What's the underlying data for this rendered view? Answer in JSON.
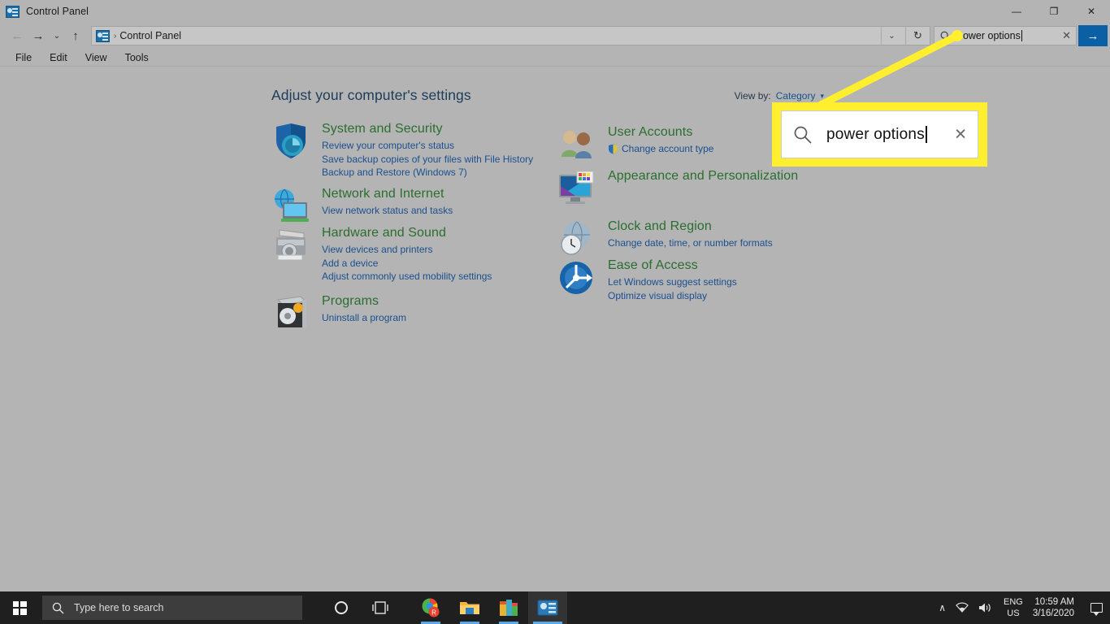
{
  "window": {
    "title": "Control Panel",
    "title_icon": "control-panel-icon",
    "minimize": "—",
    "maximize": "❐",
    "close": "✕"
  },
  "nav": {
    "back": "←",
    "forward": "→",
    "history": "⌄",
    "up": "↑",
    "breadcrumb_separator": "›",
    "breadcrumb": "Control Panel",
    "address_chevron": "⌄",
    "refresh": "↻"
  },
  "search": {
    "value": "power options",
    "clear_label": "✕",
    "go_label": "→",
    "icon": "search-icon"
  },
  "menu": {
    "items": [
      "File",
      "Edit",
      "View",
      "Tools"
    ]
  },
  "main": {
    "heading": "Adjust your computer's settings",
    "view_by_label": "View by:",
    "view_by_value": "Category",
    "view_by_caret": "▾"
  },
  "categories_left": [
    {
      "title": "System and Security",
      "icon": "shield-security-icon",
      "links": [
        "Review your computer's status",
        "Save backup copies of your files with File History",
        "Backup and Restore (Windows 7)"
      ]
    },
    {
      "title": "Network and Internet",
      "icon": "network-globe-icon",
      "links": [
        "View network status and tasks"
      ]
    },
    {
      "title": "Hardware and Sound",
      "icon": "printer-icon",
      "links": [
        "View devices and printers",
        "Add a device",
        "Adjust commonly used mobility settings"
      ]
    },
    {
      "title": "Programs",
      "icon": "programs-disc-icon",
      "links": [
        "Uninstall a program"
      ]
    }
  ],
  "categories_right": [
    {
      "title": "User Accounts",
      "icon": "user-accounts-icon",
      "links": [
        "Change account type"
      ],
      "link_shield": true
    },
    {
      "title": "Appearance and Personalization",
      "icon": "appearance-monitor-icon",
      "links": []
    },
    {
      "title": "Clock and Region",
      "icon": "clock-globe-icon",
      "links": [
        "Change date, time, or number formats"
      ]
    },
    {
      "title": "Ease of Access",
      "icon": "ease-of-access-icon",
      "links": [
        "Let Windows suggest settings",
        "Optimize visual display"
      ]
    }
  ],
  "callout": {
    "value": "power options",
    "clear_label": "✕",
    "icon": "search-icon",
    "highlight_color": "#ffef2e"
  },
  "taskbar": {
    "start_icon": "windows-logo-icon",
    "search_placeholder": "Type here to search",
    "search_icon": "search-icon",
    "cortana_icon": "cortana-icon",
    "taskview_icon": "task-view-icon",
    "apps": [
      {
        "name": "chrome-icon"
      },
      {
        "name": "file-explorer-icon"
      },
      {
        "name": "app-icon"
      },
      {
        "name": "control-panel-icon"
      }
    ],
    "tray": {
      "chevron": "∧",
      "network_icon": "wifi-icon",
      "volume_icon": "speaker-icon",
      "language_line1": "ENG",
      "language_line2": "US",
      "time": "10:59 AM",
      "date": "3/16/2020",
      "notifications_icon": "action-center-icon"
    }
  },
  "colors": {
    "window_bg": "#b4b4b4",
    "category_title": "#2a6e2f",
    "link": "#1b4f8f",
    "heading": "#1c3c5a",
    "accent": "#0a5fa5",
    "highlight": "#ffef2e",
    "taskbar": "#1f1f1f"
  }
}
